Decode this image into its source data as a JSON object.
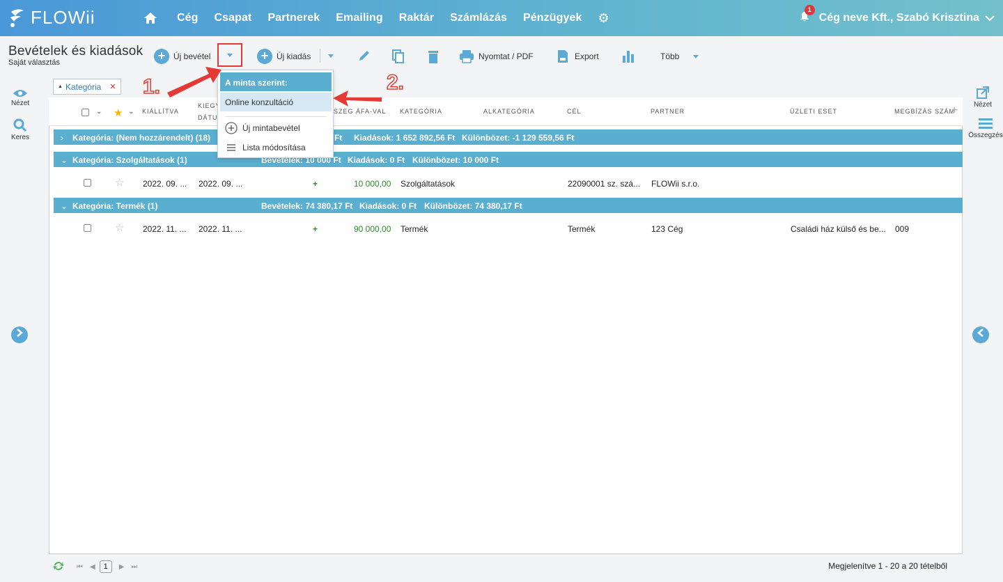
{
  "app": {
    "logo_text": "FLOWii",
    "nav": [
      "Cég",
      "Csapat",
      "Partnerek",
      "Emailing",
      "Raktár",
      "Számlázás",
      "Pénzügyek"
    ],
    "notification_count": "1",
    "user_label": "Cég neve Kft., Szabó Krisztina"
  },
  "page": {
    "title": "Bevételek és kiadások",
    "subtitle": "Saját választás"
  },
  "toolbar": {
    "new_income": "Új bevétel",
    "new_expense": "Új kiadás",
    "print": "Nyomtat / PDF",
    "export": "Export",
    "more": "Több"
  },
  "side": {
    "view": "Nézet",
    "search": "Keres",
    "right_view": "Nézet",
    "summary": "Összegzés"
  },
  "filter_chip": "Kategória",
  "columns": {
    "issued": "KIÁLLÍTVA",
    "settle_1": "KIEGY",
    "settle_2": "DÁTUM",
    "amount": "ÖSSZEG ÁFA-VAL",
    "category": "KATEGÓRIA",
    "subcategory": "ALKATEGÓRIA",
    "purpose": "CÉL",
    "partner": "PARTNER",
    "business_case": "ÜZLETI ESET",
    "order_no": "MEGBÍZÁS SZÁM"
  },
  "groups": [
    {
      "label": "Kategória: (Nem hozzárendelt) (18)",
      "income": "Ft",
      "expense": "Kiadások: 1 652 892,56 Ft",
      "diff": "Különbözet: -1 129 559,56 Ft"
    },
    {
      "label": "Kategória: Szolgáltatások (1)",
      "income": "Bevételek: 10 000 Ft",
      "expense": "Kiadások: 0 Ft",
      "diff": "Különbözet: 10 000 Ft"
    },
    {
      "label": "Kategória: Termék (1)",
      "income": "Bevételek: 74 380,17 Ft",
      "expense": "Kiadások: 0 Ft",
      "diff": "Különbözet: 74 380,17 Ft"
    }
  ],
  "rows": [
    {
      "issued": "2022. 09. ...",
      "settle": "2022. 09. ...",
      "sign": "+",
      "amount": "10 000,00",
      "category": "Szolgáltatások",
      "purpose": "22090001 sz. szá...",
      "partner": "FLOWii s.r.o.",
      "business_case": "",
      "order_no": ""
    },
    {
      "issued": "2022. 11. ...",
      "settle": "2022. 11. ...",
      "sign": "+",
      "amount": "90 000,00",
      "category": "Termék",
      "purpose": "Termék",
      "partner": "123 Cég",
      "business_case": "Családi ház külső és be...",
      "order_no": "009"
    }
  ],
  "dropdown": {
    "header": "A minta szerint:",
    "template_item": "Online konzultáció",
    "new_template": "Új mintabevétel",
    "edit_list": "Lista módosítása"
  },
  "annotations": {
    "step1": "1.",
    "step2": "2."
  },
  "footer": {
    "page": "1",
    "showing": "Megjelenítve 1 - 20 a 20 tételből"
  },
  "colors": {
    "accent": "#5aaed0",
    "annotation": "#e53935",
    "positive": "#2e8b2e"
  }
}
